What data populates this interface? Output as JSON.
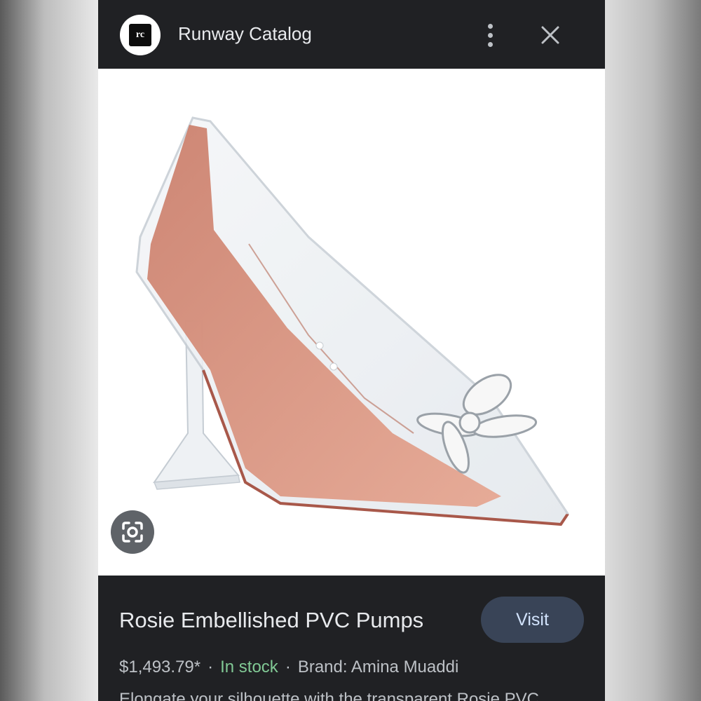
{
  "header": {
    "logo_text": "rc",
    "site_name": "Runway Catalog"
  },
  "product": {
    "title": "Rosie Embellished PVC Pumps",
    "price": "$1,493.79*",
    "stock": "In stock",
    "brand": "Brand: Amina Muaddi",
    "description": "Elongate your silhouette with the transparent Rosie PVC",
    "visit_label": "Visit"
  },
  "icons": {
    "more": "more-vert-icon",
    "close": "close-icon",
    "lens": "lens-icon"
  },
  "colors": {
    "panel_bg": "#202124",
    "visit_bg": "#394457",
    "in_stock": "#81c995"
  }
}
